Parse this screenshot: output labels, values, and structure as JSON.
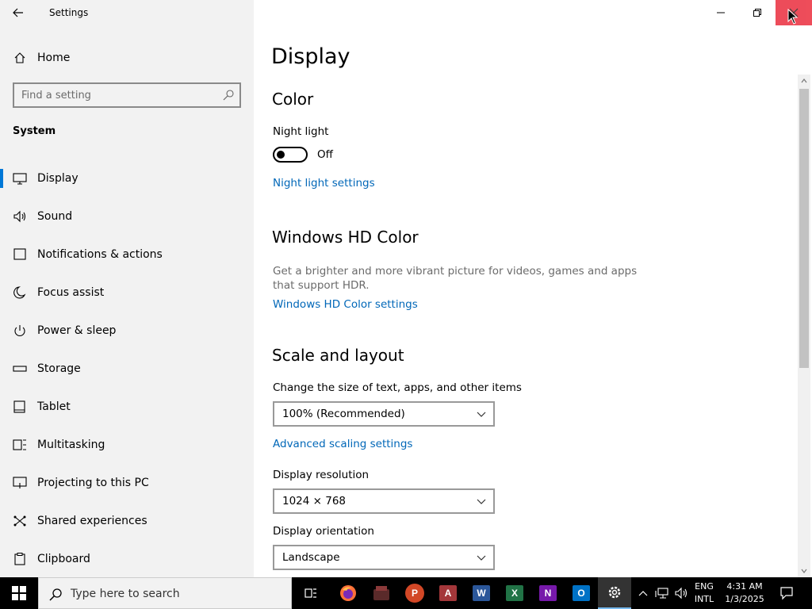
{
  "window": {
    "title": "Settings"
  },
  "sidebar": {
    "home_label": "Home",
    "search_placeholder": "Find a setting",
    "section_header": "System",
    "items": [
      {
        "label": "Display",
        "icon": "monitor-icon",
        "active": true
      },
      {
        "label": "Sound",
        "icon": "speaker-icon"
      },
      {
        "label": "Notifications & actions",
        "icon": "notification-icon"
      },
      {
        "label": "Focus assist",
        "icon": "moon-icon"
      },
      {
        "label": "Power & sleep",
        "icon": "power-icon"
      },
      {
        "label": "Storage",
        "icon": "storage-icon"
      },
      {
        "label": "Tablet",
        "icon": "tablet-icon"
      },
      {
        "label": "Multitasking",
        "icon": "multitasking-icon"
      },
      {
        "label": "Projecting to this PC",
        "icon": "projecting-icon"
      },
      {
        "label": "Shared experiences",
        "icon": "shared-experiences-icon"
      },
      {
        "label": "Clipboard",
        "icon": "clipboard-icon"
      }
    ]
  },
  "main": {
    "page_title": "Display",
    "color": {
      "heading": "Color",
      "night_light_label": "Night light",
      "night_light_state": "Off",
      "night_light_link": "Night light settings"
    },
    "hd_color": {
      "heading": "Windows HD Color",
      "description": "Get a brighter and more vibrant picture for videos, games and apps that support HDR.",
      "link": "Windows HD Color settings"
    },
    "scale_layout": {
      "heading": "Scale and layout",
      "scale_label": "Change the size of text, apps, and other items",
      "scale_value": "100% (Recommended)",
      "advanced_link": "Advanced scaling settings",
      "resolution_label": "Display resolution",
      "resolution_value": "1024 × 768",
      "orientation_label": "Display orientation",
      "orientation_value": "Landscape"
    }
  },
  "taskbar": {
    "search_placeholder": "Type here to search",
    "apps": [
      "task-view",
      "firefox",
      "app-dark",
      "powerpoint",
      "access",
      "word",
      "excel",
      "onenote",
      "outlook",
      "settings"
    ],
    "language_line1": "ENG",
    "language_line2": "INTL",
    "time": "4:31 AM",
    "date": "1/3/2025"
  },
  "colors": {
    "accent": "#0078d7",
    "link": "#0067b8",
    "sidebar_bg": "#f2f2f2",
    "close_hover": "#e81123"
  }
}
